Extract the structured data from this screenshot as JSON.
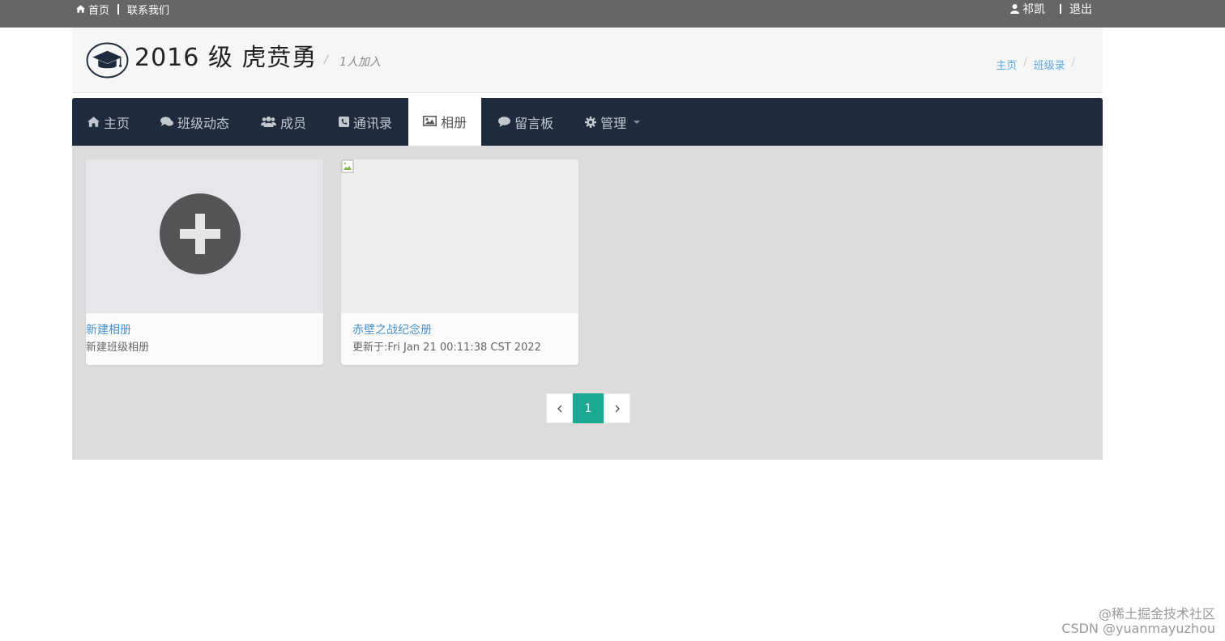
{
  "topbar": {
    "home": "首页",
    "contact": "联系我们",
    "user": "祁凯",
    "logout": "退出"
  },
  "header": {
    "title": "2016 级 虎贲勇",
    "title_sep": "/",
    "member_count": "1人加入",
    "breadcrumb": [
      {
        "label": "主页"
      },
      {
        "label": "班级录"
      }
    ],
    "breadcrumb_sep": "/"
  },
  "nav": {
    "items": [
      {
        "label": "主页",
        "icon": "home-icon"
      },
      {
        "label": "班级动态",
        "icon": "comments-icon"
      },
      {
        "label": "成员",
        "icon": "users-icon"
      },
      {
        "label": "通讯录",
        "icon": "phone-icon"
      },
      {
        "label": "相册",
        "icon": "picture-icon",
        "active": true
      },
      {
        "label": "留言板",
        "icon": "comment-icon"
      },
      {
        "label": "管理",
        "icon": "gear-icon",
        "dropdown": true
      }
    ]
  },
  "albums": {
    "new": {
      "title": "新建相册",
      "subtitle": "新建班级相册"
    },
    "items": [
      {
        "title": "赤壁之战纪念册",
        "updated": "更新于:Fri Jan 21 00:11:38 CST 2022"
      }
    ]
  },
  "pagination": {
    "prev": "‹",
    "current": "1",
    "next": "›"
  },
  "watermark": {
    "line1": "@稀土掘金技术社区",
    "line2": "CSDN @yuanmayuzhou"
  },
  "colors": {
    "topbar": "#666666",
    "nav": "#1e2b3c",
    "accent": "#1aaa91",
    "link": "#4a90c8"
  }
}
